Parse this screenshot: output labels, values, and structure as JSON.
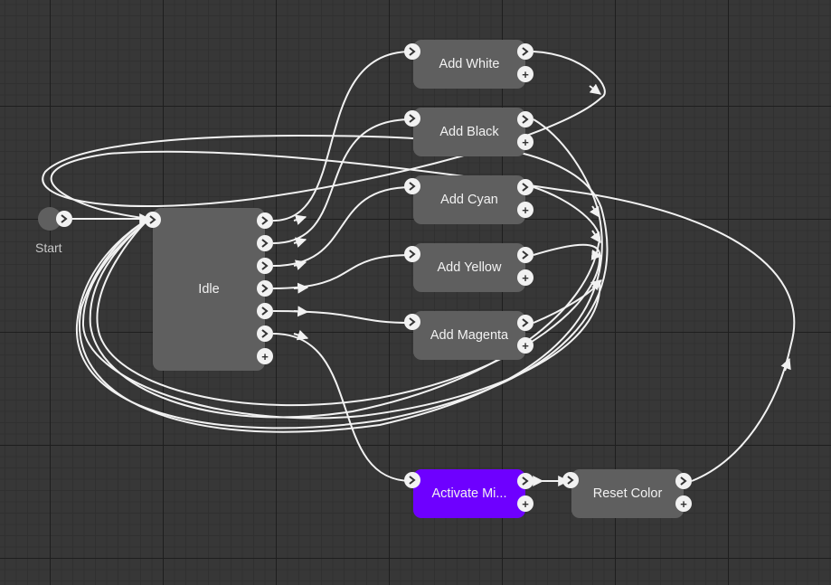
{
  "graph": {
    "start": {
      "label": "Start"
    },
    "idle": {
      "label": "Idle"
    },
    "states": [
      {
        "id": "add-white",
        "label": "Add White"
      },
      {
        "id": "add-black",
        "label": "Add Black"
      },
      {
        "id": "add-cyan",
        "label": "Add Cyan"
      },
      {
        "id": "add-yellow",
        "label": "Add Yellow"
      },
      {
        "id": "add-magenta",
        "label": "Add Magenta"
      },
      {
        "id": "activate-mix",
        "label": "Activate Mi..."
      },
      {
        "id": "reset-color",
        "label": "Reset Color"
      }
    ],
    "selected_state": "activate-mix",
    "colors": {
      "background": "#373737",
      "node": "#5f5f5f",
      "selected_node": "#6e00ff",
      "connection": "#f2f2f2"
    }
  }
}
